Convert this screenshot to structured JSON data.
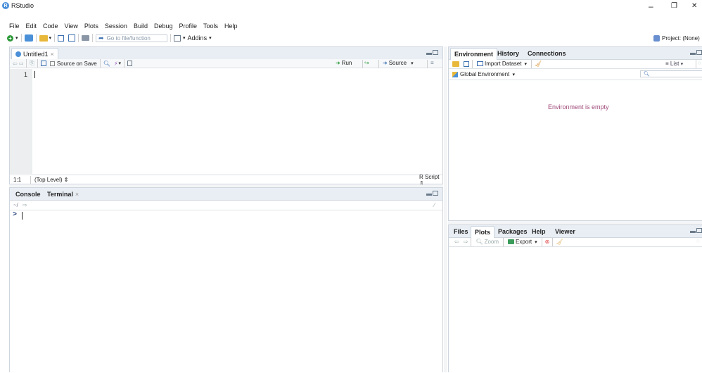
{
  "window": {
    "title": "RStudio",
    "controls": {
      "minimize": "–",
      "restore": "❐",
      "close": "✕"
    }
  },
  "menu": [
    "File",
    "Edit",
    "Code",
    "View",
    "Plots",
    "Session",
    "Build",
    "Debug",
    "Profile",
    "Tools",
    "Help"
  ],
  "toolbar": {
    "goto_placeholder": "Go to file/function",
    "addins_label": "Addins",
    "project_label": "Project: (None)"
  },
  "editor": {
    "tab_label": "Untitled1",
    "source_on_save_label": "Source on Save",
    "run_label": "Run",
    "source_label": "Source",
    "line_number": "1",
    "cursor_pos": "1:1",
    "scope": "(Top Level)",
    "file_type": "R Script"
  },
  "console": {
    "tabs": [
      "Console",
      "Terminal"
    ],
    "path": "~/",
    "prompt": ">"
  },
  "environment": {
    "tabs": [
      "Environment",
      "History",
      "Connections"
    ],
    "import_label": "Import Dataset",
    "list_label": "List",
    "scope_label": "Global Environment",
    "empty_message": "Environment is empty"
  },
  "files": {
    "tabs": [
      "Files",
      "Plots",
      "Packages",
      "Help",
      "Viewer"
    ],
    "zoom_label": "Zoom",
    "export_label": "Export"
  },
  "colors": {
    "accent": "#4a90d9",
    "empty_text": "#a04a7a"
  }
}
